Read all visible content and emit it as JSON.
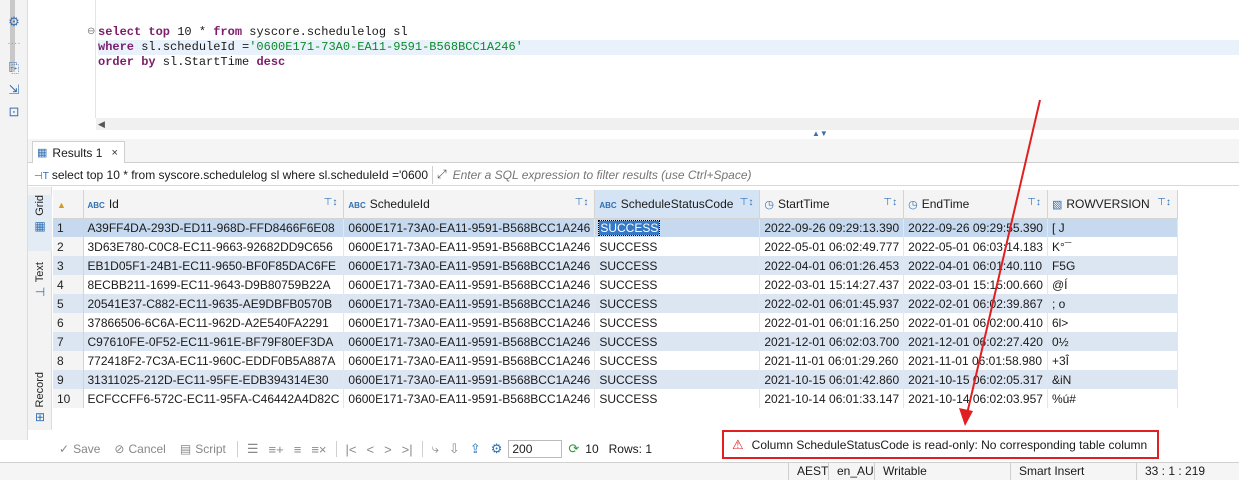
{
  "editor": {
    "line1": {
      "kw1": "select top",
      "p1": " 10 * ",
      "kw2": "from",
      "p2": " syscore.schedulelog sl"
    },
    "line2": {
      "kw1": "where",
      "p1": " sl.scheduleId =",
      "str": "'0600E171-73A0-EA11-9591-B568BCC1A246'"
    },
    "line3": {
      "kw1": "order by",
      "p1": " sl.StartTime ",
      "kw2": "desc"
    },
    "fold_icon": "collapse-icon"
  },
  "results_tab": {
    "label": "Results 1",
    "icon": "grid-icon",
    "close": "×"
  },
  "filter_bar": {
    "query": "select top 10 * from syscore.schedulelog sl where sl.scheduleId ='0600E",
    "placeholder": "Enter a SQL expression to filter results (use Ctrl+Space)"
  },
  "side_tabs": {
    "grid": "Grid",
    "text": "Text",
    "record": "Record"
  },
  "grid": {
    "columns": [
      {
        "name": "Id",
        "type": "ABC"
      },
      {
        "name": "ScheduleId",
        "type": "ABC"
      },
      {
        "name": "ScheduleStatusCode",
        "type": "ABC"
      },
      {
        "name": "StartTime",
        "type": "clock"
      },
      {
        "name": "EndTime",
        "type": "clock"
      },
      {
        "name": "ROWVERSION",
        "type": "binary"
      }
    ],
    "rows": [
      [
        "1",
        "A39FF4DA-293D-ED11-968D-FFD8466F6E08",
        "0600E171-73A0-EA11-9591-B568BCC1A246",
        "SUCCESS",
        "2022-09-26 09:29:13.390",
        "2022-09-26 09:29:55.390",
        "[ J"
      ],
      [
        "2",
        "3D63E780-C0C8-EC11-9663-92682DD9C656",
        "0600E171-73A0-EA11-9591-B568BCC1A246",
        "SUCCESS",
        "2022-05-01 06:02:49.777",
        "2022-05-01 06:03:14.183",
        "K°¯"
      ],
      [
        "3",
        "EB1D05F1-24B1-EC11-9650-BF0F85DAC6FE",
        "0600E171-73A0-EA11-9591-B568BCC1A246",
        "SUCCESS",
        "2022-04-01 06:01:26.453",
        "2022-04-01 06:01:40.110",
        "F5G"
      ],
      [
        "4",
        "8ECBB211-1699-EC11-9643-D9B80759B22A",
        "0600E171-73A0-EA11-9591-B568BCC1A246",
        "SUCCESS",
        "2022-03-01 15:14:27.437",
        "2022-03-01 15:15:00.660",
        "@Í"
      ],
      [
        "5",
        "20541E37-C882-EC11-9635-AE9DBFB0570B",
        "0600E171-73A0-EA11-9591-B568BCC1A246",
        "SUCCESS",
        "2022-02-01 06:01:45.937",
        "2022-02-01 06:02:39.867",
        "; o"
      ],
      [
        "6",
        "37866506-6C6A-EC11-962D-A2E540FA2291",
        "0600E171-73A0-EA11-9591-B568BCC1A246",
        "SUCCESS",
        "2022-01-01 06:01:16.250",
        "2022-01-01 06:02:00.410",
        "6l>"
      ],
      [
        "7",
        "C97610FE-0F52-EC11-961E-BF79F80EF3DA",
        "0600E171-73A0-EA11-9591-B568BCC1A246",
        "SUCCESS",
        "2021-12-01 06:02:03.700",
        "2021-12-01 06:02:27.420",
        "0½"
      ],
      [
        "8",
        "772418F2-7C3A-EC11-960C-EDDF0B5A887A",
        "0600E171-73A0-EA11-9591-B568BCC1A246",
        "SUCCESS",
        "2021-11-01 06:01:29.260",
        "2021-11-01 06:01:58.980",
        "+3Î"
      ],
      [
        "9",
        "31311025-212D-EC11-95FE-EDB394314E30",
        "0600E171-73A0-EA11-9591-B568BCC1A246",
        "SUCCESS",
        "2021-10-15 06:01:42.860",
        "2021-10-15 06:02:05.317",
        "&iN"
      ],
      [
        "10",
        "ECFCCFF6-572C-EC11-95FA-C46442A4D82C",
        "0600E171-73A0-EA11-9591-B568BCC1A246",
        "SUCCESS",
        "2021-10-14 06:01:33.147",
        "2021-10-14 06:02:03.957",
        "%ú#"
      ]
    ],
    "selected_row": 0,
    "selected_col": 2
  },
  "bottom_toolbar": {
    "save": "Save",
    "cancel": "Cancel",
    "script": "Script",
    "fetch_size": "200",
    "fetched_count": "10",
    "rows_label": "Rows: 1"
  },
  "error": {
    "message": "Column ScheduleStatusCode is read-only: No corresponding table column"
  },
  "status_bar": {
    "timezone": "AEST",
    "locale": "en_AU",
    "mode": "Writable",
    "insert_mode": "Smart Insert",
    "position": "33 : 1 : 219"
  },
  "colors": {
    "accent": "#2f6fb3",
    "error": "#e02020",
    "row_alt": "#dce6f2",
    "selection": "#3478c6"
  }
}
